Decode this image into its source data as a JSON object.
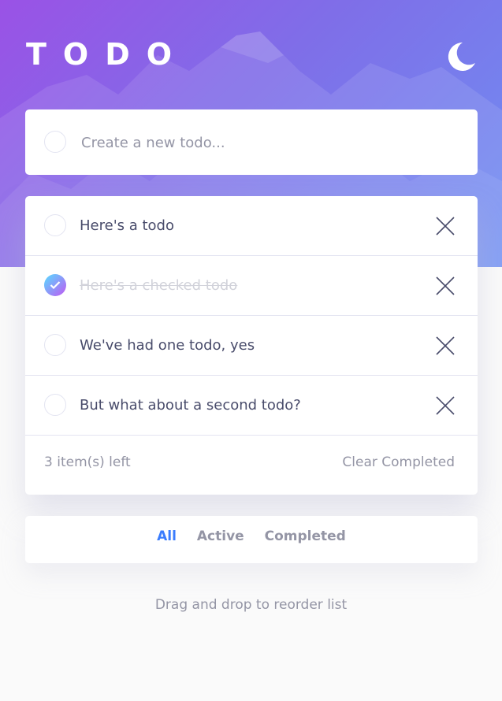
{
  "app": {
    "title": "TODO",
    "theme_icon": "moon-icon",
    "accent_color": "#3a7cfd",
    "check_gradient": [
      "#57ddff",
      "#c058f3"
    ]
  },
  "create": {
    "placeholder": "Create a new todo..."
  },
  "todos": [
    {
      "text": "Here's a todo",
      "completed": false
    },
    {
      "text": "Here's a checked todo",
      "completed": true
    },
    {
      "text": "We've had one todo, yes",
      "completed": false
    },
    {
      "text": "But what about a second todo?",
      "completed": false
    }
  ],
  "footer": {
    "items_left": "3 item(s) left",
    "clear_completed": "Clear Completed"
  },
  "filters": {
    "all": "All",
    "active": "Active",
    "completed": "Completed",
    "selected": "All"
  },
  "hint": "Drag and drop to reorder list"
}
